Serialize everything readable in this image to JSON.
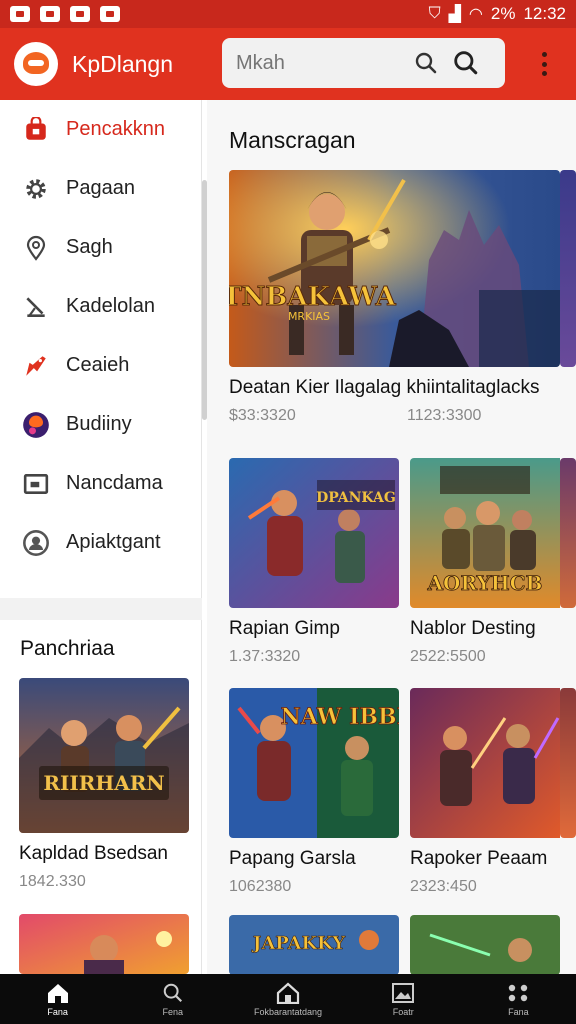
{
  "status_bar": {
    "battery": "2%",
    "time": "12:32"
  },
  "app_bar": {
    "title": "KpDlangn",
    "search_placeholder": "Mkah"
  },
  "sidebar": {
    "items": [
      {
        "label": "Pencakknn",
        "icon": "bag-icon",
        "active": true
      },
      {
        "label": "Pagaan",
        "icon": "gear-icon",
        "active": false
      },
      {
        "label": "Sagh",
        "icon": "location-pin-icon",
        "active": false
      },
      {
        "label": "Kadelolan",
        "icon": "antenna-icon",
        "active": false
      },
      {
        "label": "Ceaieh",
        "icon": "tag-icon",
        "active": false
      },
      {
        "label": "Budiiny",
        "icon": "profile-badge-icon",
        "active": false
      },
      {
        "label": "Nancdama",
        "icon": "box-icon",
        "active": false
      },
      {
        "label": "Apiaktgant",
        "icon": "account-icon",
        "active": false
      }
    ],
    "section_title": "Panchriaa",
    "cards": [
      {
        "title": "Kapldad Bsedsan",
        "price": "1842.330"
      },
      {
        "title": "",
        "price": ""
      }
    ]
  },
  "main": {
    "section_title": "Manscragan",
    "featured": {
      "art_title": "TNBAKAWA",
      "art_subtitle": "MRKIAS",
      "title": "Deatan Kier Ilagalag khiintalitaglacks",
      "price_left": "$33:3320",
      "price_right": "1123:3300"
    },
    "grid": [
      {
        "title": "Rapian Gimp",
        "price": "1.37:3320",
        "art_title": "DPANKAG"
      },
      {
        "title": "Nablor Desting",
        "price": "2522:5500",
        "art_title": "AORYHCB"
      },
      {
        "title": "Papang Garsla",
        "price": "1062380",
        "art_title": "NAW IBBNB"
      },
      {
        "title": "Rapoker Peaam",
        "price": "2323:450",
        "art_title": ""
      },
      {
        "title": "",
        "price": "",
        "art_title": "JAPAKKY"
      },
      {
        "title": "",
        "price": "",
        "art_title": ""
      }
    ]
  },
  "bottom_nav": [
    {
      "label": "Fana",
      "icon": "home-icon",
      "active": true
    },
    {
      "label": "Fena",
      "icon": "search-icon",
      "active": false
    },
    {
      "label": "Fokbarantatdang",
      "icon": "store-icon",
      "active": false
    },
    {
      "label": "Foatr",
      "icon": "image-icon",
      "active": false
    },
    {
      "label": "Fana",
      "icon": "more-apps-icon",
      "active": false
    }
  ],
  "colors": {
    "accent": "#e0321f",
    "status_bar": "#c8281c",
    "active_text": "#d6281c",
    "bottom_nav": "#0b0b0b"
  }
}
